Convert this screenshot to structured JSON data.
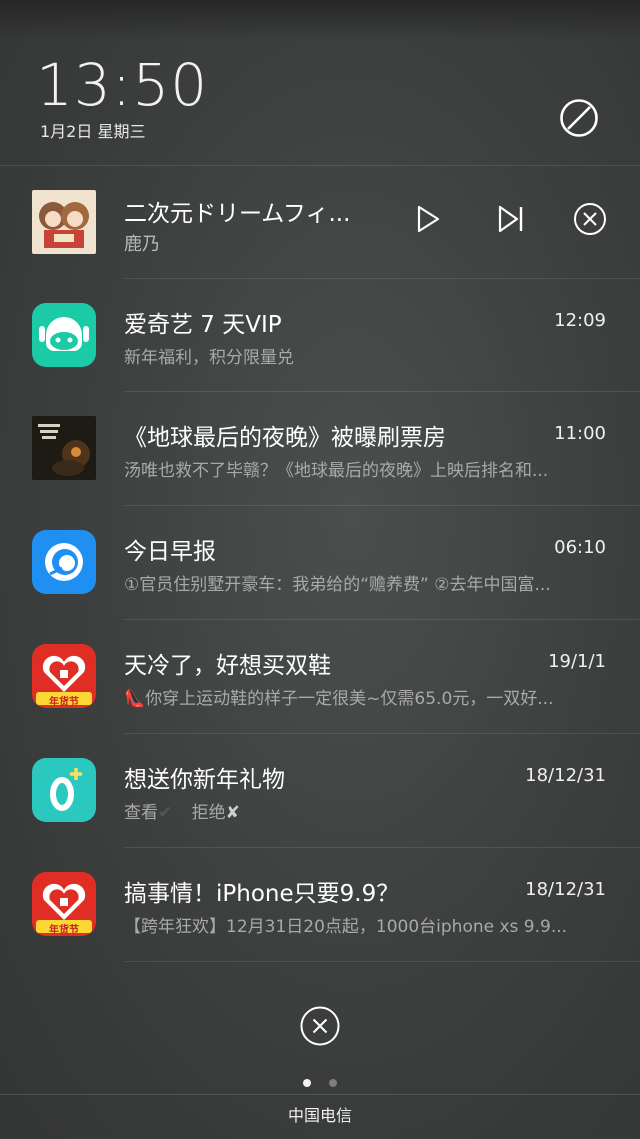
{
  "lockscreen": {
    "time": "13:50",
    "date": "1月2日 星期三"
  },
  "media": {
    "title": "二次元ドリームフィ...",
    "artist": "鹿乃"
  },
  "notifications": [
    {
      "app": "iqiyi",
      "title": "爱奇艺 7 天VIP",
      "time": "12:09",
      "body": "新年福利，积分限量兑",
      "icon_color": "#19c9a6"
    },
    {
      "app": "movie",
      "title": "《地球最后的夜晚》被曝刷票房",
      "time": "11:00",
      "body": "汤唯也救不了毕赣？《地球最后的夜晚》上映后排名和...",
      "icon_color": "#2a2218"
    },
    {
      "app": "news",
      "title": "今日早报",
      "time": "06:10",
      "body": "①官员住别墅开豪车：我弟给的“赡养费” ②去年中国富...",
      "icon_color": "#1f8ff2"
    },
    {
      "app": "pinduoduo",
      "title": "天冷了，好想买双鞋",
      "time": "19/1/1",
      "body": "👠你穿上运动鞋的样子一定很美~仅需65.0元，一双好...",
      "icon_color": "#e02e24",
      "badge": "年货节"
    },
    {
      "app": "plus-app",
      "title": "想送你新年礼物",
      "time": "18/12/31",
      "body_parts": {
        "view": "查看",
        "reject": "拒绝"
      },
      "icon_color": "#2bc8c0"
    },
    {
      "app": "pinduoduo",
      "title": "搞事情！iPhone只要9.9？",
      "time": "18/12/31",
      "body": "【跨年狂欢】12月31日20点起，1000台iphone xs 9.9...",
      "icon_color": "#e02e24",
      "badge": "年货节"
    }
  ],
  "pager": {
    "count": 2,
    "active": 0
  },
  "status": {
    "carrier": "中国电信"
  },
  "icons": [
    "do-not-disturb-icon",
    "play-icon",
    "skip-next-icon",
    "close-icon",
    "clear-all-icon"
  ]
}
